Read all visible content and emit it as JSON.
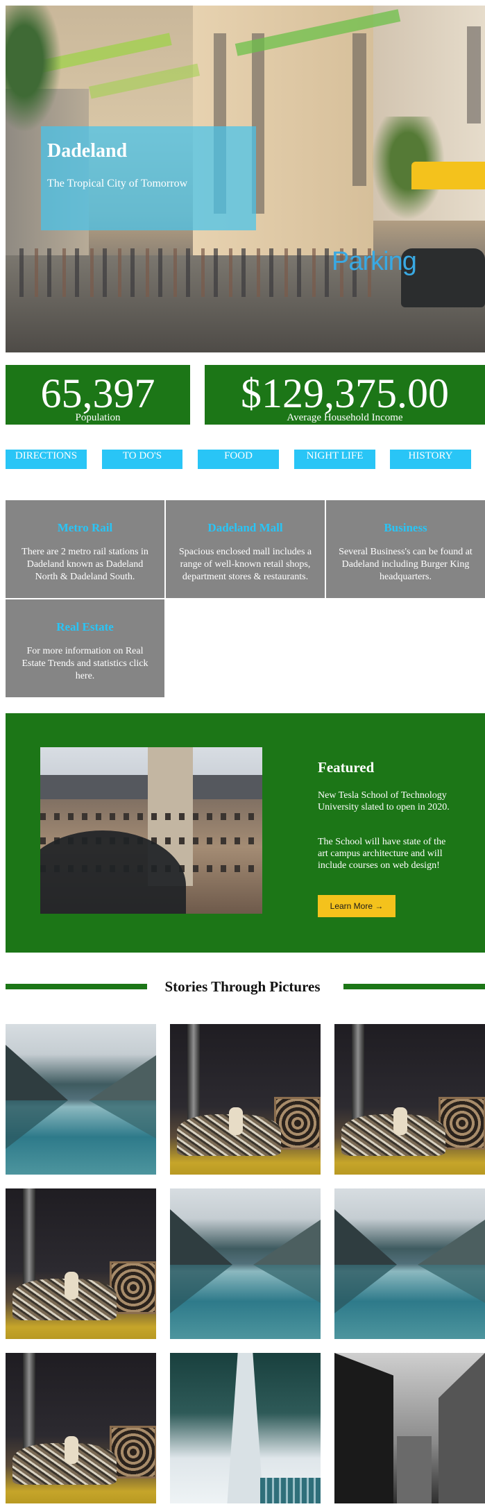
{
  "hero": {
    "title": "Dadeland",
    "subtitle": "The Tropical City of Tomorrow",
    "image_sign": "Parking"
  },
  "stats": [
    {
      "value": "65,397",
      "label": "Population"
    },
    {
      "value": "$129,375.00",
      "label": "Average Household Income"
    }
  ],
  "nav": [
    {
      "label": "DIRECTIONS"
    },
    {
      "label": "TO DO'S"
    },
    {
      "label": "FOOD"
    },
    {
      "label": "NIGHT LIFE"
    },
    {
      "label": "HISTORY"
    }
  ],
  "info_cards": [
    {
      "title": "Metro Rail",
      "text": "There are 2 metro rail stations in Dadeland known as Dadeland North & Dadeland South."
    },
    {
      "title": "Dadeland Mall",
      "text": "Spacious enclosed mall includes a range of well-known retail shops, department stores & restaurants."
    },
    {
      "title": "Business",
      "text": "Several Business's can be found at Dadeland including Burger King headquarters."
    },
    {
      "title": "Real Estate",
      "text": "For more information on Real Estate Trends and statistics click here."
    }
  ],
  "featured": {
    "title": "Featured",
    "paragraph1": "New Tesla School of Technology University slated to open in 2020.",
    "paragraph2": "The School will have state of the art campus architecture and will include courses on web design!",
    "button_label": "Learn More →"
  },
  "stories": {
    "title": "Stories Through Pictures",
    "photos": [
      "lake",
      "cables",
      "cables",
      "cables",
      "lake",
      "lake",
      "cables",
      "bridge",
      "alley"
    ]
  },
  "colors": {
    "green": "#1c7617",
    "sky_blue": "#29c5f6",
    "gray_card": "#858585",
    "yellow_button": "#f4c21c"
  }
}
